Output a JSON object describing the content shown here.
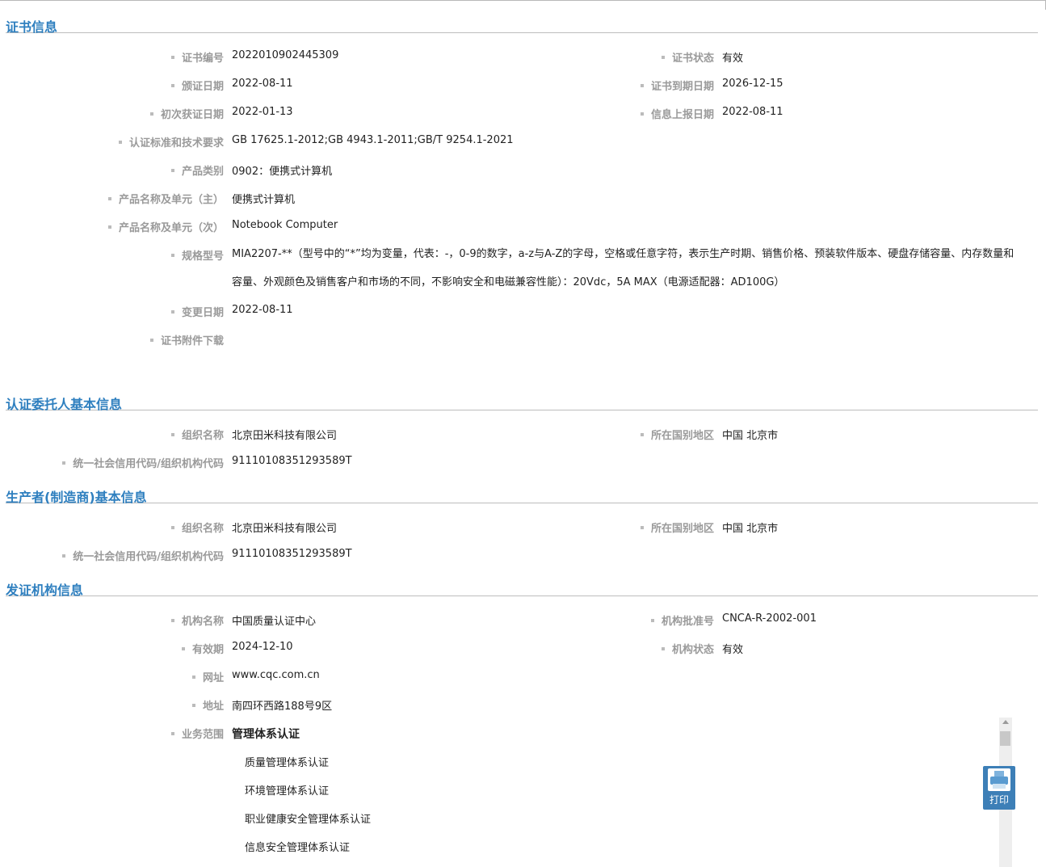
{
  "sections": {
    "certificate": {
      "title": "证书信息",
      "cert_no_label": "证书编号",
      "cert_no": "2022010902445309",
      "status_label": "证书状态",
      "status": "有效",
      "issue_date_label": "颁证日期",
      "issue_date": "2022-08-11",
      "expiry_label": "证书到期日期",
      "expiry": "2026-12-15",
      "first_date_label": "初次获证日期",
      "first_date": "2022-01-13",
      "report_date_label": "信息上报日期",
      "report_date": "2022-08-11",
      "standard_label": "认证标准和技术要求",
      "standard": "GB 17625.1-2012;GB 4943.1-2011;GB/T 9254.1-2021",
      "category_label": "产品类别",
      "category": "0902：便携式计算机",
      "name_main_label": "产品名称及单元（主）",
      "name_main": "便携式计算机",
      "name_sub_label": "产品名称及单元（次）",
      "name_sub": "Notebook Computer",
      "model_label": "规格型号",
      "model": "MIA2207-**（型号中的“*”均为变量，代表：-，0-9的数字，a-z与A-Z的字母，空格或任意字符，表示生产时期、销售价格、预装软件版本、硬盘存储容量、内存数量和容量、外观颜色及销售客户和市场的不同，不影响安全和电磁兼容性能）：20Vdc，5A MAX（电源适配器：AD100G）",
      "change_date_label": "变更日期",
      "change_date": "2022-08-11",
      "attachment_label": "证书附件下载"
    },
    "applicant": {
      "title": "认证委托人基本信息",
      "org_label": "组织名称",
      "org": "北京田米科技有限公司",
      "region_label": "所在国别地区",
      "region": "中国 北京市",
      "code_label": "统一社会信用代码/组织机构代码",
      "code": "91110108351293589T"
    },
    "manufacturer": {
      "title": "生产者(制造商)基本信息",
      "org_label": "组织名称",
      "org": "北京田米科技有限公司",
      "region_label": "所在国别地区",
      "region": "中国 北京市",
      "code_label": "统一社会信用代码/组织机构代码",
      "code": "91110108351293589T"
    },
    "issuer": {
      "title": "发证机构信息",
      "name_label": "机构名称",
      "name": "中国质量认证中心",
      "approval_label": "机构批准号",
      "approval": "CNCA-R-2002-001",
      "valid_label": "有效期",
      "valid": "2024-12-10",
      "org_status_label": "机构状态",
      "org_status": "有效",
      "website_label": "网址",
      "website": "www.cqc.com.cn",
      "address_label": "地址",
      "address": "南四环西路188号9区",
      "scope_label": "业务范围",
      "scope_head": "管理体系认证",
      "scope_items": [
        "质量管理体系认证",
        "环境管理体系认证",
        "职业健康安全管理体系认证",
        "信息安全管理体系认证"
      ]
    }
  },
  "print_button": {
    "label": "打印",
    "icon": "printer-icon"
  }
}
